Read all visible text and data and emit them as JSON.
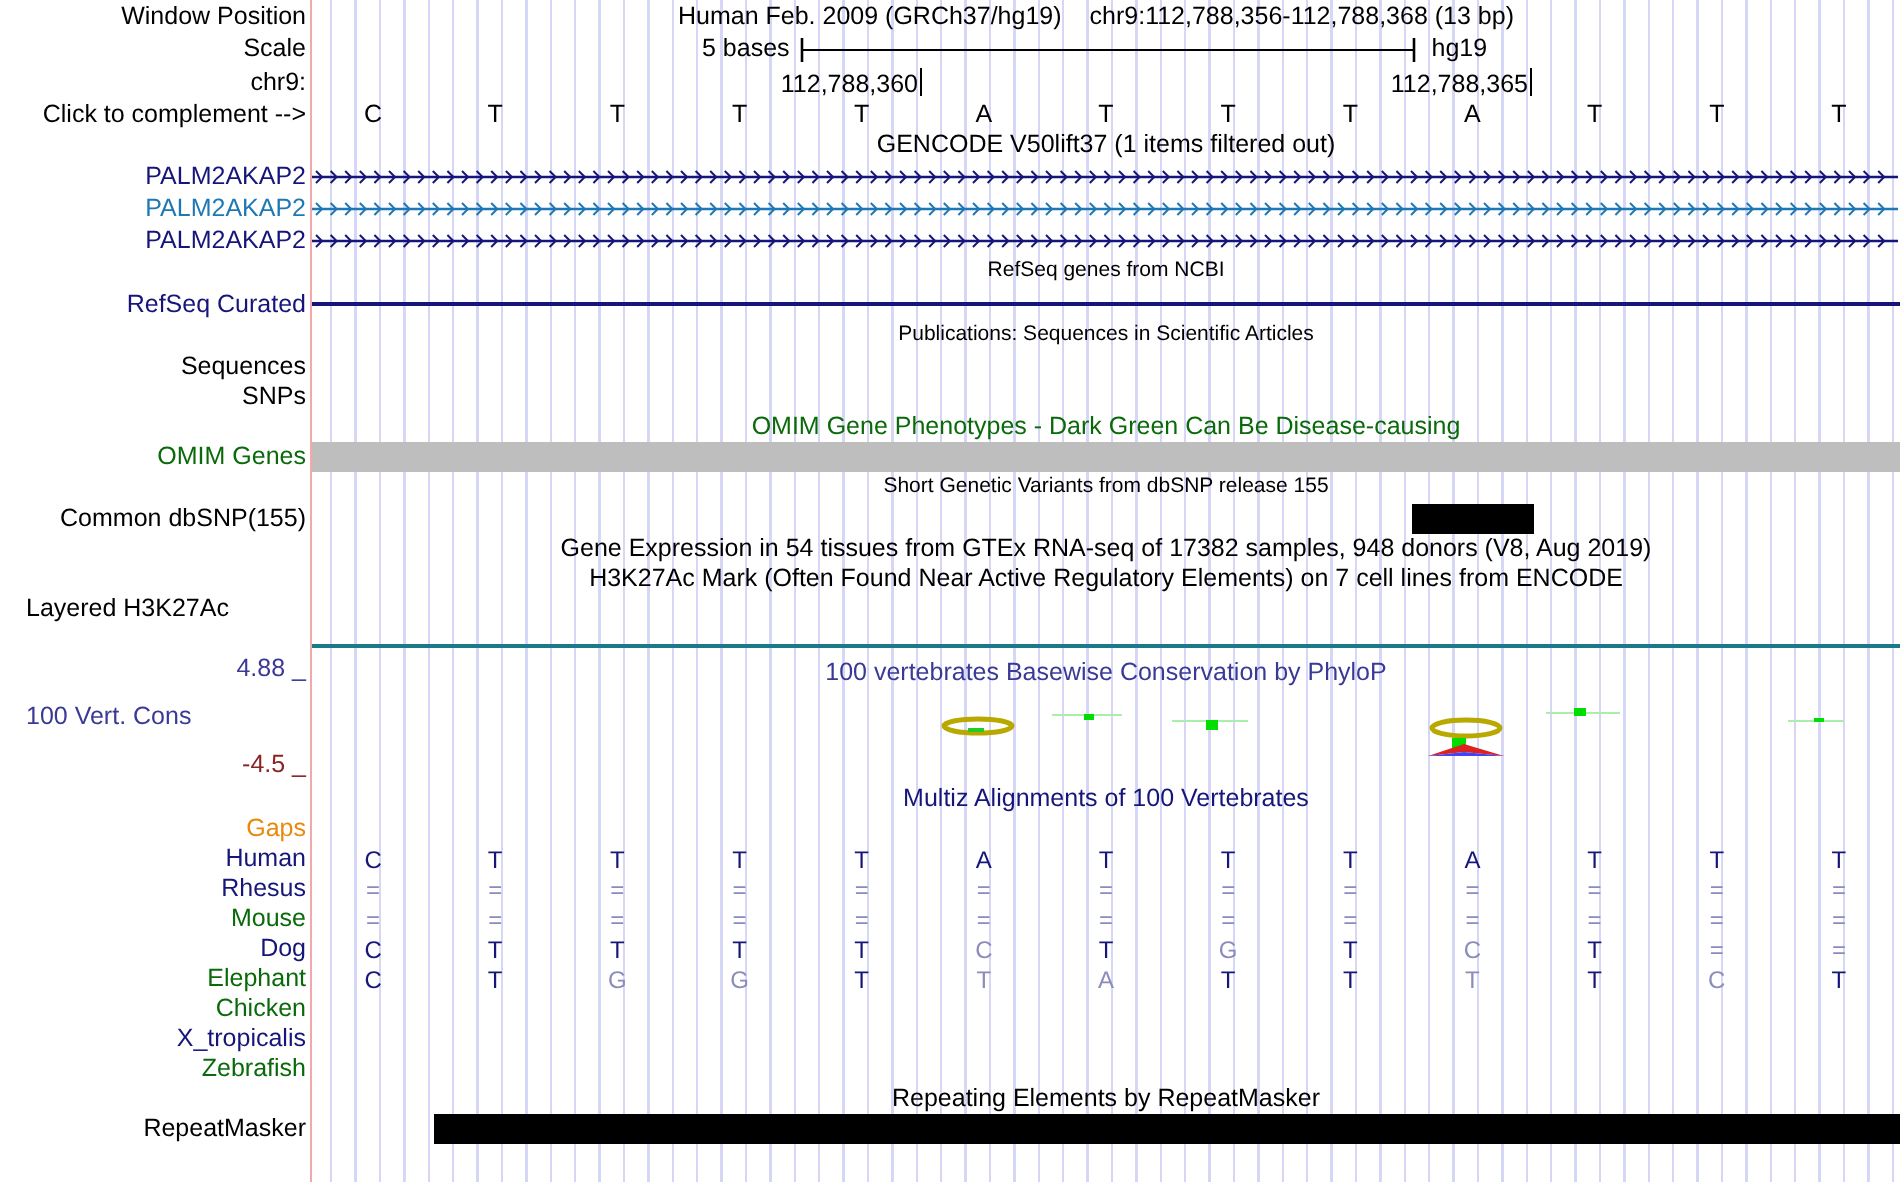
{
  "position_row": {
    "label": "Window Position",
    "assembly": "Human Feb. 2009 (GRCh37/hg19)",
    "range": "chr9:112,788,356-112,788,368 (13 bp)"
  },
  "scale_row": {
    "label": "Scale",
    "scale_text": "5 bases",
    "database": "hg19"
  },
  "coordinate_row": {
    "label": "chr9:",
    "ticks": [
      "112,788,360",
      "112,788,365"
    ]
  },
  "sequence_row": {
    "label": "Click to complement -->",
    "bases": [
      "C",
      "T",
      "T",
      "T",
      "T",
      "A",
      "T",
      "T",
      "T",
      "A",
      "T",
      "T",
      "T"
    ]
  },
  "tracks": [
    {
      "kind": "title",
      "text": "GENCODE V50lift37 (1 items filtered out)",
      "color": "#000000"
    },
    {
      "kind": "gene",
      "label": "PALM2AKAP2",
      "color": "#16167a"
    },
    {
      "kind": "gene",
      "label": "PALM2AKAP2",
      "color": "#1f78b4"
    },
    {
      "kind": "gene",
      "label": "PALM2AKAP2",
      "color": "#16167a"
    },
    {
      "kind": "small_title",
      "text": "RefSeq genes from NCBI",
      "color": "#000000"
    },
    {
      "kind": "line",
      "label": "RefSeq Curated",
      "color": "#16167a"
    },
    {
      "kind": "small_title",
      "text": "Publications: Sequences in Scientific Articles",
      "color": "#000000"
    },
    {
      "kind": "label",
      "label": "Sequences",
      "color": "#000000"
    },
    {
      "kind": "label",
      "label": "SNPs",
      "color": "#000000"
    },
    {
      "kind": "title",
      "text": "OMIM Gene Phenotypes - Dark Green Can Be Disease-causing",
      "color": "#0a6a0a"
    },
    {
      "kind": "greybar",
      "label": "OMIM Genes",
      "color": "#0a6a0a",
      "covered": [
        true,
        true,
        true,
        true,
        true,
        true,
        true,
        true,
        true,
        true,
        true,
        true,
        true
      ]
    },
    {
      "kind": "small_title",
      "text": "Short Genetic Variants from dbSNP release 155",
      "color": "#000000"
    },
    {
      "kind": "bar",
      "label": "Common dbSNP(155)",
      "color": "#000000",
      "covered": [
        false,
        false,
        false,
        false,
        false,
        false,
        false,
        false,
        false,
        true,
        false,
        false,
        false
      ]
    },
    {
      "kind": "title",
      "text": "Gene Expression in 54 tissues from GTEx RNA-seq of 17382 samples, 948 donors (V8, Aug 2019)",
      "color": "#000000"
    },
    {
      "kind": "title",
      "text": "H3K27Ac Mark (Often Found Near Active Regulatory Elements) on 7 cell lines from ENCODE",
      "color": "#000000"
    },
    {
      "kind": "layered",
      "label": "Layered H3K27Ac",
      "color": "#000000"
    },
    {
      "kind": "conservation",
      "title": "100 vertebrates Basewise Conservation by PhyloP",
      "label": "100 Vert. Cons",
      "max_tick": "4.88 _",
      "min_tick": "-4.5 _",
      "color": "#3a3a96"
    },
    {
      "kind": "title",
      "text": "Multiz Alignments of 100 Vertebrates",
      "color": "#16167a"
    },
    {
      "kind": "label",
      "label": "Gaps",
      "color": "#e8890c"
    },
    {
      "kind": "alignment",
      "species": [
        {
          "name": "Human",
          "color": "#16167a",
          "bases": [
            "C",
            "T",
            "T",
            "T",
            "T",
            "A",
            "T",
            "T",
            "T",
            "A",
            "T",
            "T",
            "T"
          ]
        },
        {
          "name": "Rhesus",
          "color": "#16167a",
          "bases": [
            "=",
            "=",
            "=",
            "=",
            "=",
            "=",
            "=",
            "=",
            "=",
            "=",
            "=",
            "=",
            "="
          ]
        },
        {
          "name": "Mouse",
          "color": "#0a6a0a",
          "bases": [
            "=",
            "=",
            "=",
            "=",
            "=",
            "=",
            "=",
            "=",
            "=",
            "=",
            "=",
            "=",
            "="
          ]
        },
        {
          "name": "Dog",
          "color": "#16167a",
          "bases": [
            "C",
            "T",
            "T",
            "T",
            "T",
            "C",
            "T",
            "G",
            "T",
            "C",
            "T",
            "=",
            "="
          ]
        },
        {
          "name": "Elephant",
          "color": "#0a6a0a",
          "bases": [
            "C",
            "T",
            "G",
            "G",
            "T",
            "T",
            "A",
            "T",
            "T",
            "T",
            "T",
            "C",
            "T"
          ]
        },
        {
          "name": "Chicken",
          "color": "#0a6a0a"
        },
        {
          "name": "X_tropicalis",
          "color": "#16167a"
        },
        {
          "name": "Zebrafish",
          "color": "#0a6a0a"
        }
      ]
    },
    {
      "kind": "title",
      "text": "Repeating Elements by RepeatMasker",
      "color": "#000000"
    },
    {
      "kind": "bar",
      "label": "RepeatMasker",
      "color": "#000000",
      "covered": [
        false,
        true,
        true,
        true,
        true,
        true,
        true,
        true,
        true,
        true,
        true,
        true,
        true
      ]
    }
  ]
}
